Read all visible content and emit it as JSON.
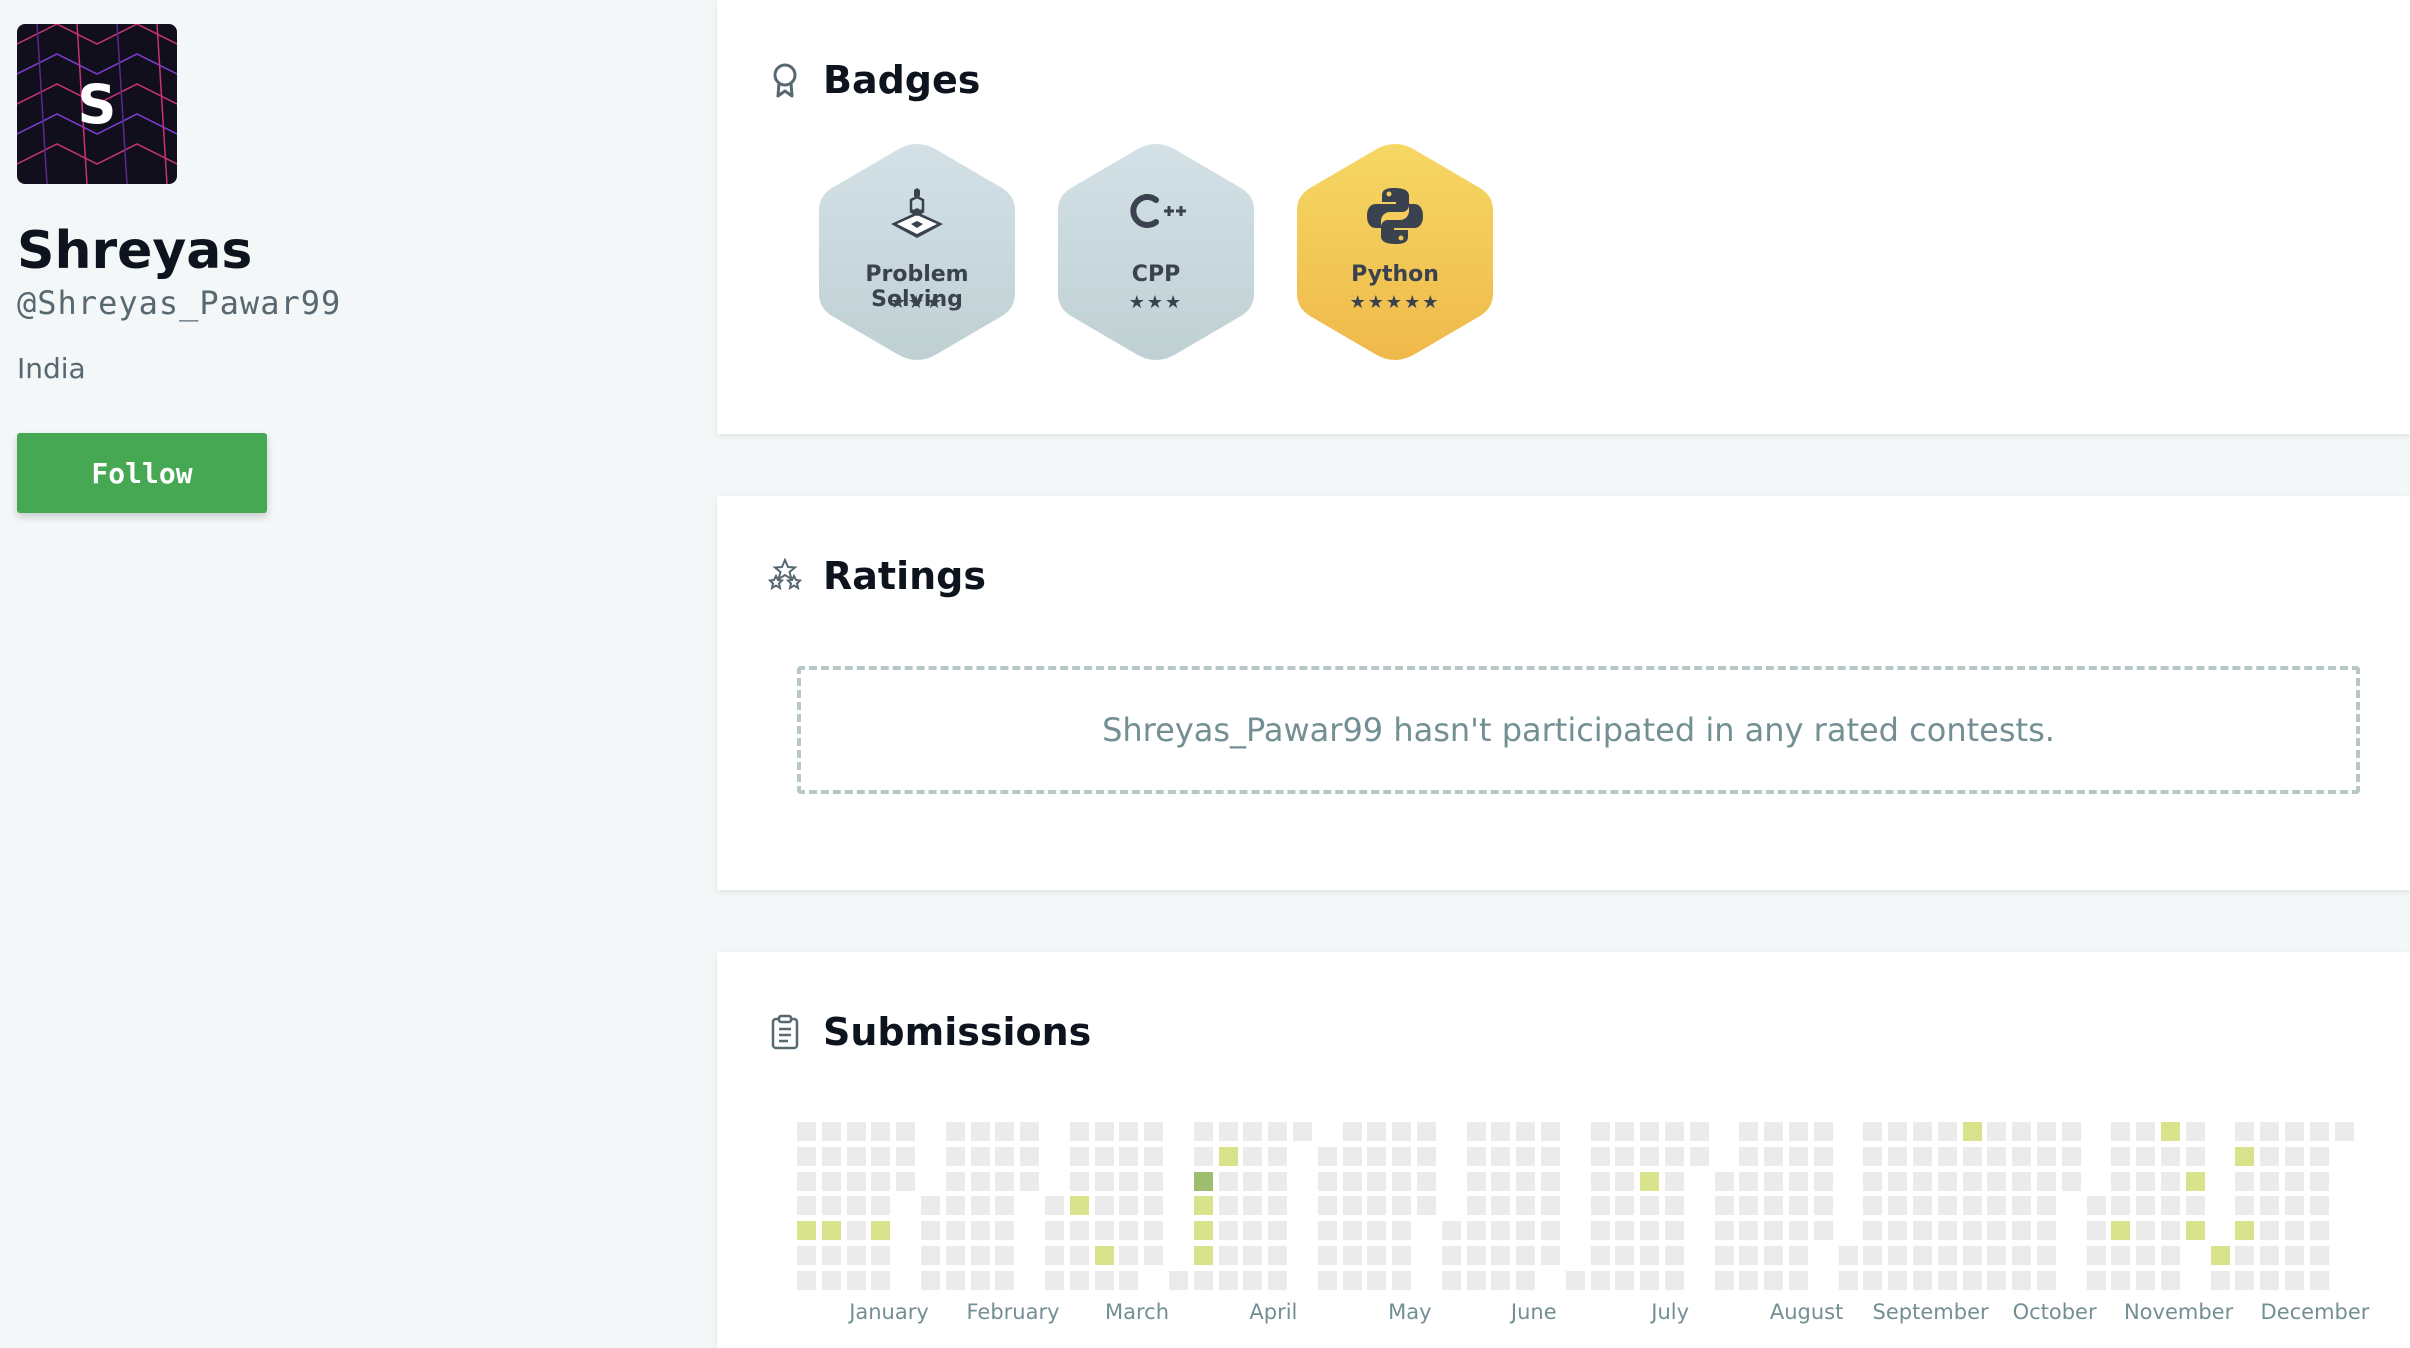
{
  "profile": {
    "avatar_letter": "S",
    "name": "Shreyas",
    "handle": "@Shreyas_Pawar99",
    "country": "India",
    "follow_label": "Follow"
  },
  "badges": {
    "title": "Badges",
    "icon": "award-ribbon-icon",
    "items": [
      {
        "name": "Problem Solving",
        "stars": "★★★",
        "icon": "problem-solving-icon",
        "color": "silver"
      },
      {
        "name": "CPP",
        "stars": "★★★",
        "icon": "cpp-icon",
        "color": "silver"
      },
      {
        "name": "Python",
        "stars": "★★★★★",
        "icon": "python-icon",
        "color": "gold"
      }
    ]
  },
  "ratings": {
    "title": "Ratings",
    "icon": "stars-icon",
    "empty_message": "Shreyas_Pawar99 hasn't participated in any rated contests."
  },
  "submissions": {
    "title": "Submissions",
    "icon": "clipboard-icon",
    "months": [
      "January",
      "February",
      "March",
      "April",
      "May",
      "June",
      "July",
      "August",
      "September",
      "October",
      "November",
      "December"
    ],
    "colors": {
      "empty": "#ebebeb",
      "level1": "#d9e38c",
      "level2": "#9ebd6e"
    }
  }
}
